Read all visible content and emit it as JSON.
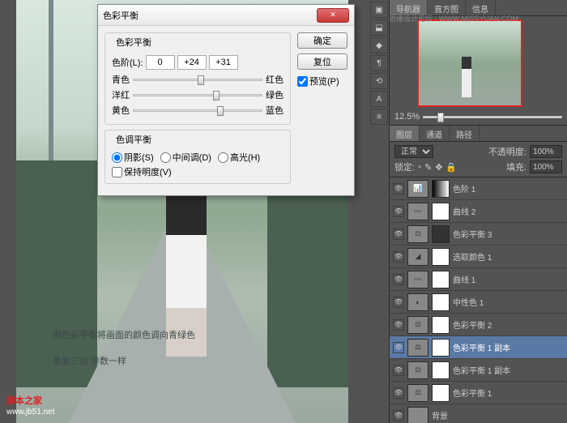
{
  "dialog": {
    "title": "色彩平衡",
    "ok": "确定",
    "cancel": "复位",
    "preview": "预览(P)",
    "group1": "色彩平衡",
    "levels_label": "色阶(L):",
    "levels": [
      "0",
      "+24",
      "+31"
    ],
    "pairs": [
      {
        "l": "青色",
        "r": "红色",
        "pos": 50
      },
      {
        "l": "洋红",
        "r": "绿色",
        "pos": 62
      },
      {
        "l": "黄色",
        "r": "蓝色",
        "pos": 65
      }
    ],
    "group2": "色调平衡",
    "tones": {
      "shadows": "阴影(S)",
      "mid": "中间调(D)",
      "high": "高光(H)"
    },
    "preserve": "保持明度(V)"
  },
  "nav": {
    "tabs": [
      "导航器",
      "直方图",
      "信息"
    ],
    "zoom": "12.5%"
  },
  "layers_panel": {
    "tabs": [
      "图层",
      "通道",
      "路径"
    ],
    "blend": "正常",
    "opacity_label": "不透明度:",
    "opacity": "100%",
    "lock_label": "锁定:",
    "fill_label": "填充:",
    "fill": "100%"
  },
  "layers": [
    {
      "name": "色阶 1",
      "icon": "📊",
      "mask": "grad"
    },
    {
      "name": "曲线 2",
      "icon": "〰",
      "mask": "white"
    },
    {
      "name": "色彩平衡 3",
      "icon": "⚖",
      "mask": "dark"
    },
    {
      "name": "选取颜色 1",
      "icon": "◢",
      "mask": "white"
    },
    {
      "name": "曲线 1",
      "icon": "〰",
      "mask": "white"
    },
    {
      "name": "中性色 1",
      "icon": "◐",
      "mask": "white"
    },
    {
      "name": "色彩平衡 2",
      "icon": "⚖",
      "mask": "white"
    },
    {
      "name": "色彩平衡 1 副本",
      "icon": "⚖",
      "mask": "white",
      "selected": true
    },
    {
      "name": "色彩平衡 1 副本",
      "icon": "⚖",
      "mask": "white"
    },
    {
      "name": "色彩平衡 1",
      "icon": "⚖",
      "mask": "white"
    },
    {
      "name": "背景",
      "icon": "",
      "mask": ""
    }
  ],
  "caption": {
    "l1": "用色彩平衡将画面的颜色调向青绿色",
    "l2": "重复三次 参数一样"
  },
  "watermark": {
    "brand": "脚本之家",
    "url": "www.jb51.net"
  },
  "watermark2": "思缘设计论坛 - WWW.MISSYUAN.COM"
}
